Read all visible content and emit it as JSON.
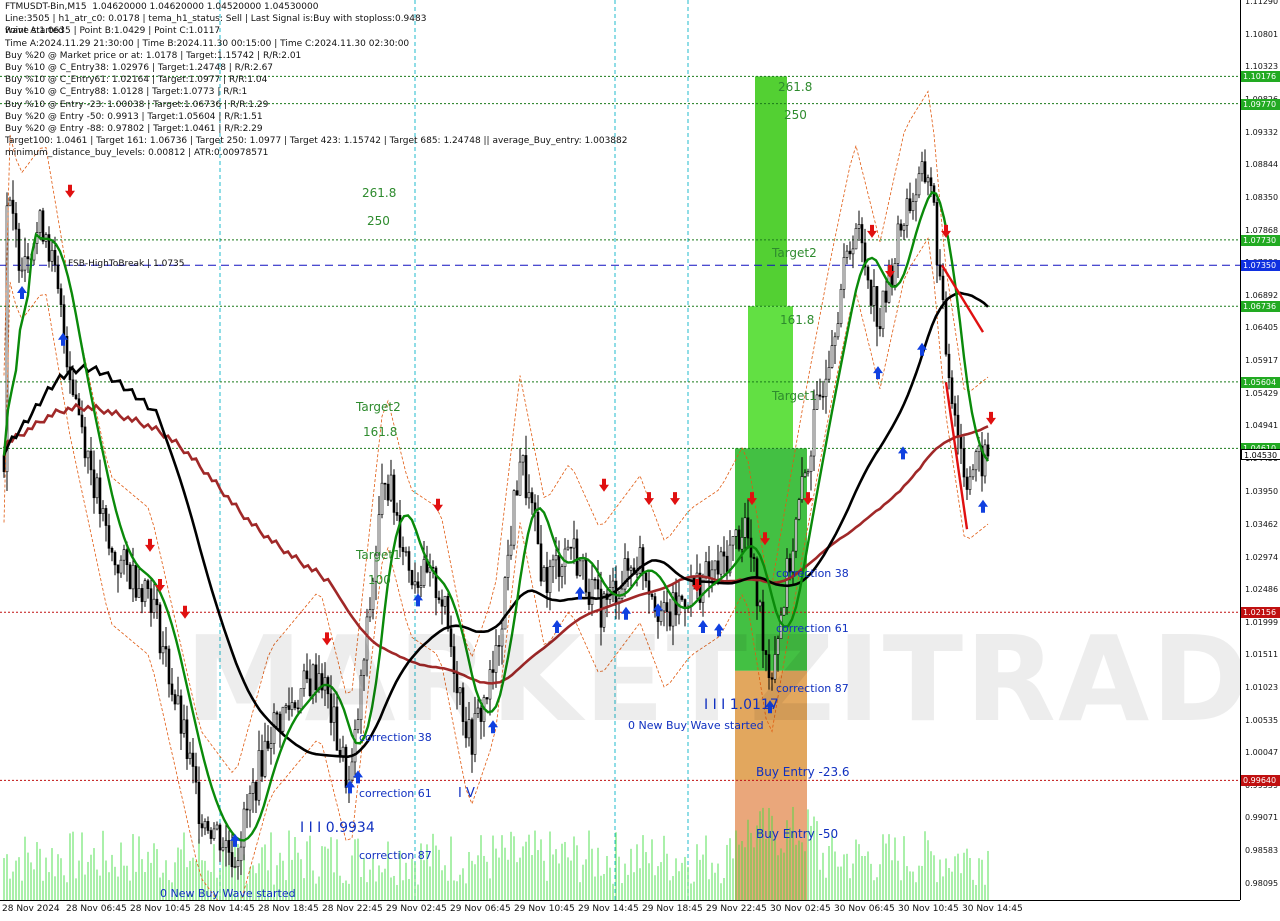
{
  "info_lines": [
    "FTMUSDT-Bin,M15  1.04620000 1.04620000 1.04520000 1.04530000",
    "Line:3505 | h1_atr_c0: 0.0178 | tema_h1_status: Sell | Last Signal is:Buy with stoploss:0.9483",
    "Point A:1.0635 | Point B:1.0429 | Point C:1.0117",
    "Time A:2024.11.29 21:30:00 | Time B:2024.11.30 00:15:00 | Time C:2024.11.30 02:30:00",
    "Buy %20 @ Market price or at: 1.0178 | Target:1.15742 | R/R:2.01",
    "Buy %10 @ C_Entry38: 1.02976 | Target:1.24748 | R/R:2.67",
    "Buy %10 @ C_Entry61: 1.02164 | Target:1.0977 | R/R:1.04",
    "Buy %10 @ C_Entry88: 1.0128 | Target:1.0773 | R/R:1",
    "Buy %10 @ Entry -23: 1.00038 | Target:1.06736 | R/R:1.29",
    "Buy %20 @ Entry -50: 0.9913 | Target:1.05604 | R/R:1.51",
    "Buy %20 @ Entry -88: 0.97802 | Target:1.0461 | R/R:2.29",
    "Target100: 1.0461 | Target 161: 1.06736 | Target 250: 1.0977 | Target 423: 1.15742 | Target 685: 1.24748 || average_Buy_entry: 1.003882",
    "minimum_distance_buy_levels: 0.00812 | ATR:0.00978571"
  ],
  "wave_started": "wave started",
  "watermark": "MARKETZITRADE",
  "chart_data": {
    "type": "candlestick",
    "symbol": "FTMUSDT-Bin",
    "timeframe": "M15",
    "ylim": [
      0.9785,
      1.1132
    ],
    "price_ticks": [
      "1.11290",
      "1.10801",
      "1.10323",
      "1.09826",
      "1.09332",
      "1.08844",
      "1.08350",
      "1.07868",
      "1.07380",
      "1.06892",
      "1.06405",
      "1.05917",
      "1.05429",
      "1.04941",
      "1.04450",
      "1.03950",
      "1.03462",
      "1.02974",
      "1.02486",
      "1.01999",
      "1.01511",
      "1.01023",
      "1.00535",
      "1.00047",
      "0.99559",
      "0.99071",
      "0.98583",
      "0.98095"
    ],
    "time_ticks": [
      "28 Nov 2024",
      "28 Nov 06:45",
      "28 Nov 10:45",
      "28 Nov 14:45",
      "28 Nov 18:45",
      "28 Nov 22:45",
      "29 Nov 02:45",
      "29 Nov 06:45",
      "29 Nov 10:45",
      "29 Nov 14:45",
      "29 Nov 18:45",
      "29 Nov 22:45",
      "30 Nov 02:45",
      "30 Nov 06:45",
      "30 Nov 10:45",
      "30 Nov 14:45"
    ],
    "levels": [
      {
        "price": 1.10176,
        "label": "1.10176",
        "color": "#1a7a1a",
        "style": "dotted"
      },
      {
        "price": 1.0977,
        "label": "1.09770",
        "color": "#1a7a1a",
        "style": "dotted"
      },
      {
        "price": 1.0773,
        "label": "1.07730",
        "color": "#1a7a1a",
        "style": "dotted"
      },
      {
        "price": 1.0735,
        "label": "1.07350",
        "color": "#1010c0",
        "style": "dashed"
      },
      {
        "price": 1.06736,
        "label": "1.06736",
        "color": "#1a7a1a",
        "style": "dotted"
      },
      {
        "price": 1.05604,
        "label": "1.05604",
        "color": "#1a7a1a",
        "style": "dotted"
      },
      {
        "price": 1.0461,
        "label": "1.04610",
        "color": "#1a7a1a",
        "style": "dotted"
      },
      {
        "price": 1.02156,
        "label": "1.02156",
        "color": "#c01010",
        "style": "dotted"
      },
      {
        "price": 0.9964,
        "label": "0.99640",
        "color": "#c01010",
        "style": "dotted"
      }
    ],
    "current_price": {
      "price": 1.0453,
      "label": "1.04530"
    },
    "zones": [
      {
        "name": "green-top",
        "from": 1.10176,
        "to": 1.06736,
        "color": "#44cc22"
      },
      {
        "name": "green-mid",
        "from": 1.06736,
        "to": 1.0461,
        "color": "#55dd33"
      },
      {
        "name": "green-low",
        "from": 1.0461,
        "to": 1.0128,
        "color": "#33bb33"
      },
      {
        "name": "orange-upper",
        "from": 1.0128,
        "to": 0.9964,
        "color": "#e0a050"
      },
      {
        "name": "orange-lower",
        "from": 0.9964,
        "to": 0.97802,
        "color": "#e8a070"
      }
    ],
    "last_close": 1.0453,
    "ma_colors": {
      "fast": "#0a8a0a",
      "slow": "#000000",
      "long": "#a02828"
    }
  },
  "annotations": {
    "lbl_2618_left": "261.8",
    "lbl_250_left": "250",
    "lbl_target2_left": "Target2",
    "lbl_1618_left": "161.8",
    "lbl_target1_left": "Target1",
    "lbl_100_left": "100",
    "lbl_2618_right": "261.8",
    "lbl_250_right": "250",
    "lbl_target2_right": "Target2",
    "lbl_1618_right": "161.8",
    "lbl_target1_right": "Target1",
    "fsb": "FSB-HighToBreak | 1.0735",
    "correction38_left": "correction 38",
    "correction61_left": "correction 61",
    "correction87_left": "correction 87",
    "wave_low_left": "I I I 0.9934",
    "new_buy_left": "0 New Buy Wave started",
    "correction38_right": "correction 38",
    "correction61_right": "correction 61",
    "correction87_right": "correction 87",
    "wave_low_right": "I I I 1.0117",
    "new_buy_right": "0 New Buy Wave started",
    "buy_entry_236": "Buy Entry -23.6",
    "buy_entry_50": "Buy Entry -50",
    "iv_mark": "I V"
  }
}
